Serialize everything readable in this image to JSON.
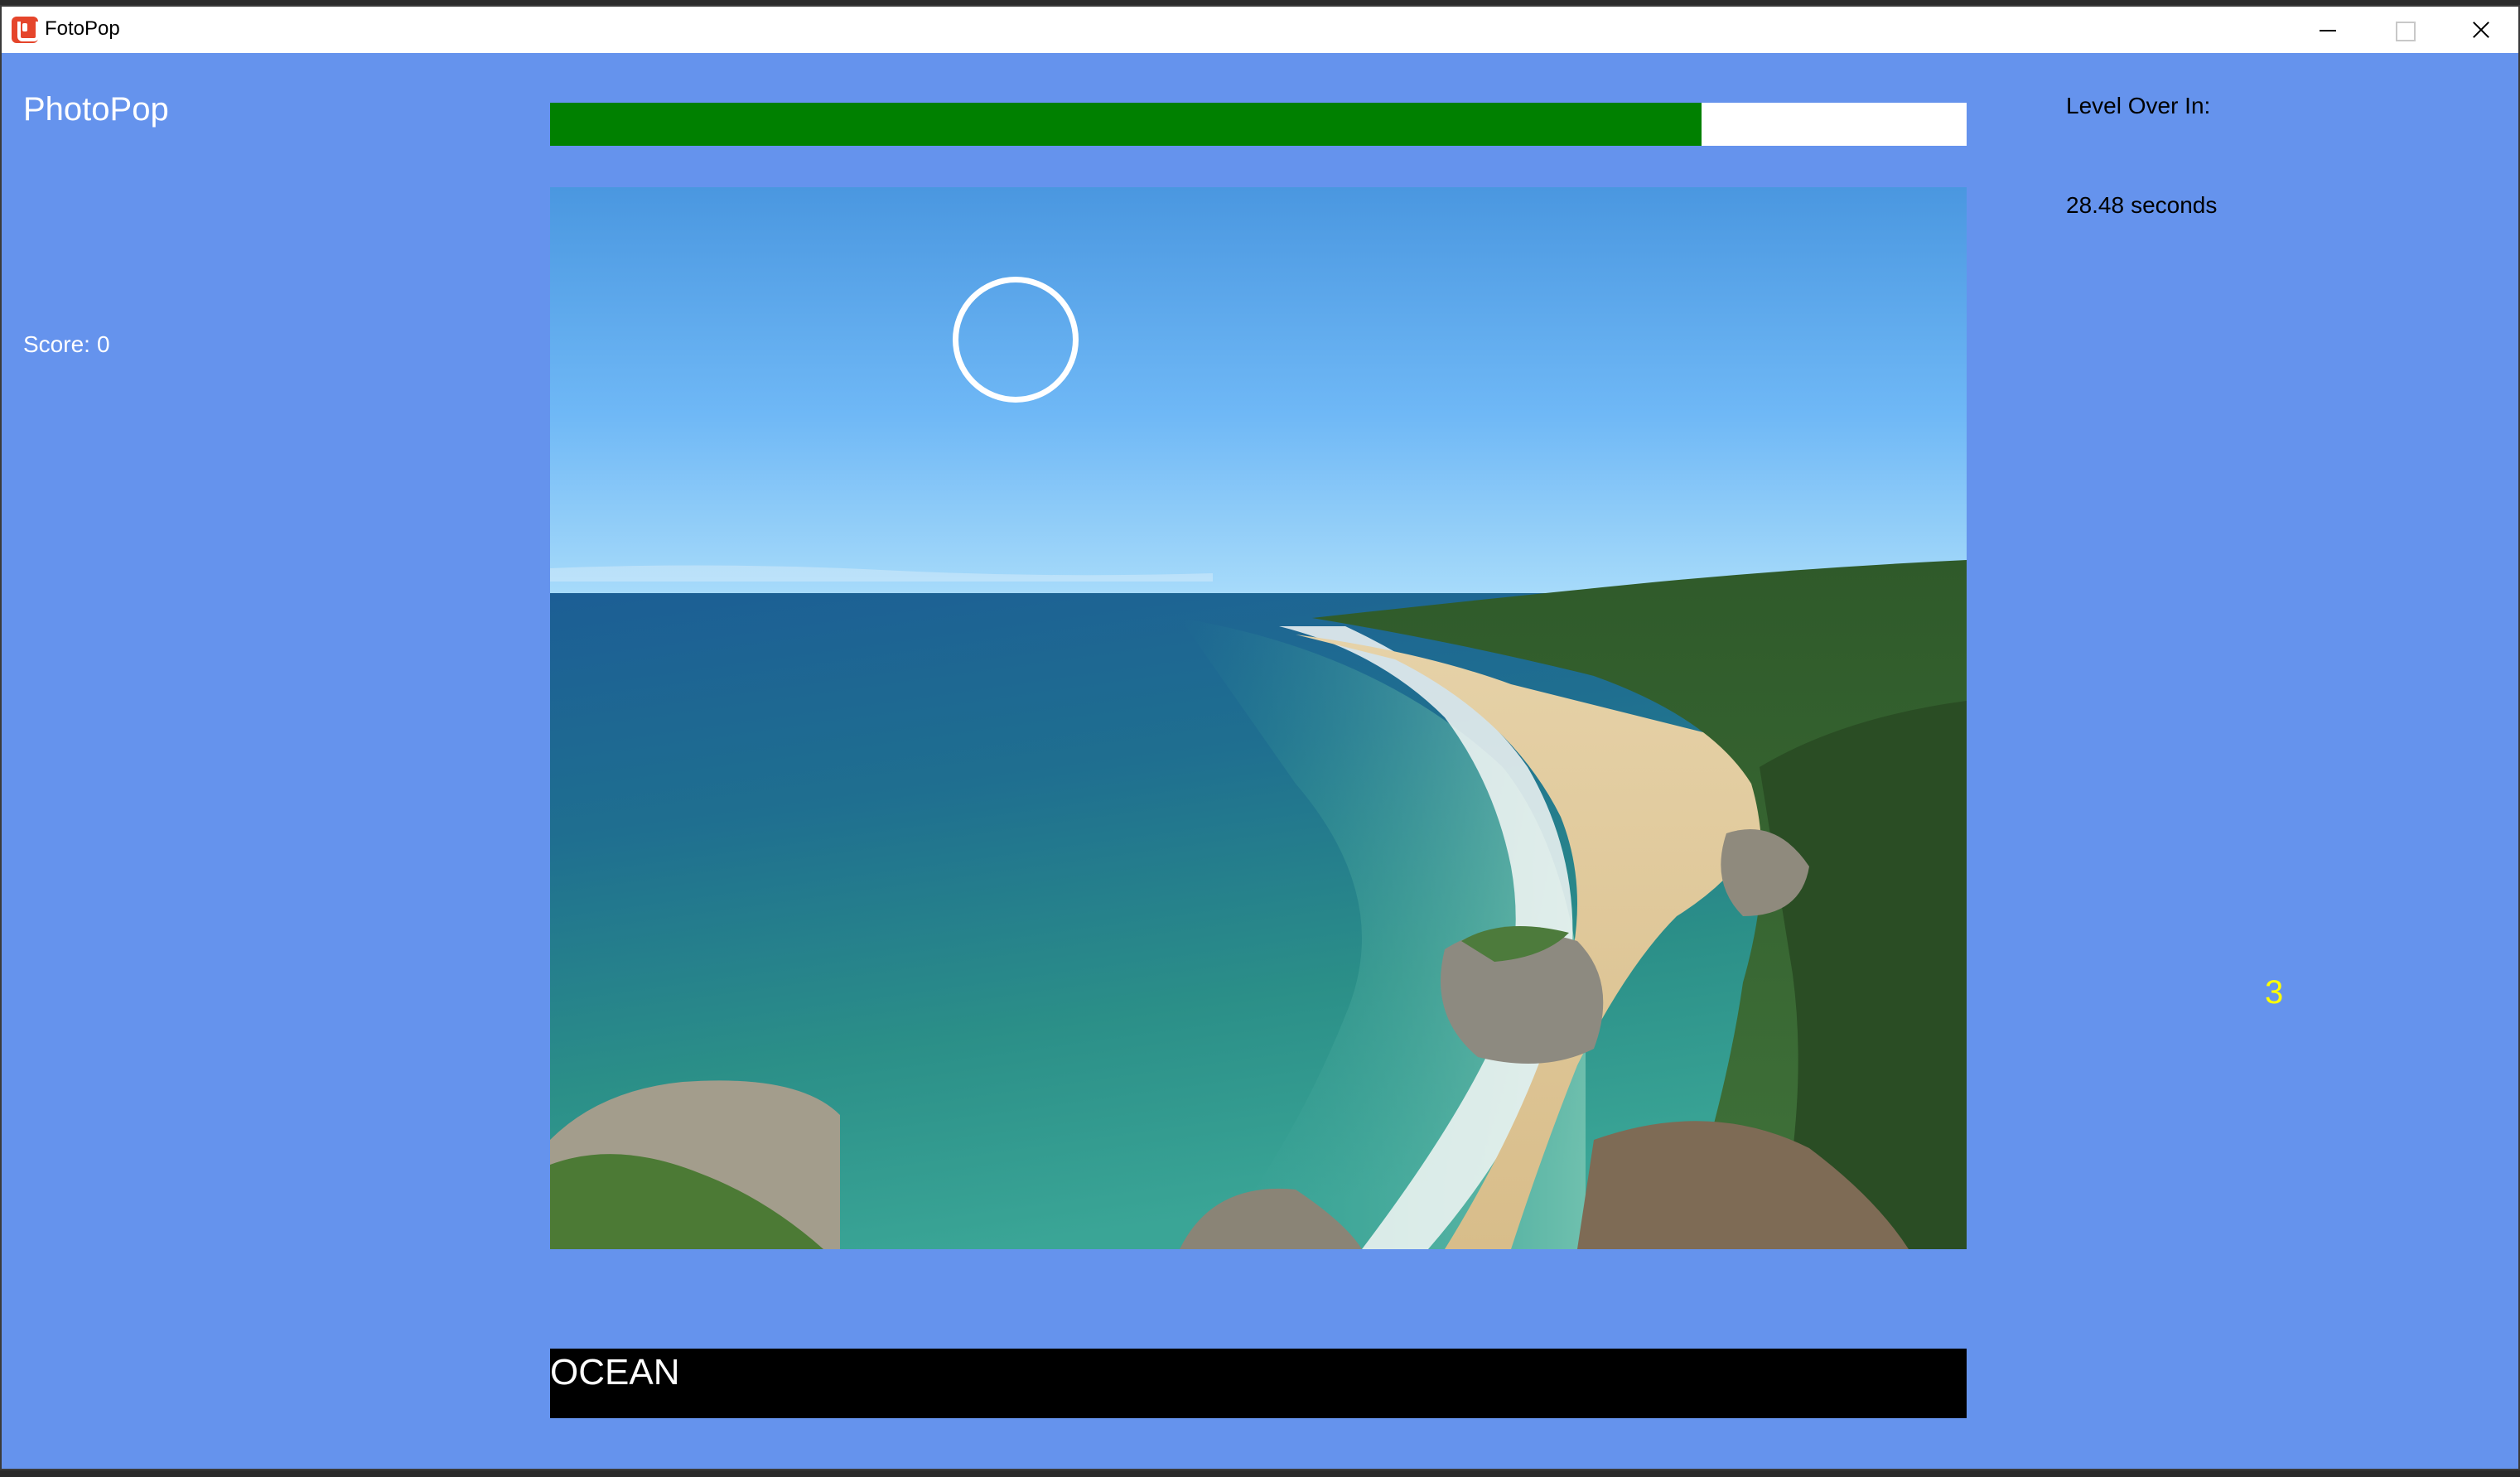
{
  "window": {
    "title": "FotoPop",
    "app_icon": "fotopop-logo-icon",
    "controls": [
      "minimize-icon",
      "maximize-icon",
      "close-icon"
    ]
  },
  "game": {
    "title": "PhotoPop",
    "score_label": "Score:",
    "score_value": "0",
    "level_label": "Level Over In:",
    "time_value": "28.48",
    "time_unit": "seconds",
    "counter": "3",
    "answer": "OCEAN",
    "timer_progress": 0.813
  },
  "photo": {
    "subject": "coastal beach scene with turquoise ocean, sandy shore, rocky cliffs and green hills"
  },
  "colors": {
    "background": "#6593ed",
    "timer_fill": "#008000",
    "timer_track": "#ffffff",
    "counter": "#ffff00",
    "answer_bar": "#000000"
  }
}
